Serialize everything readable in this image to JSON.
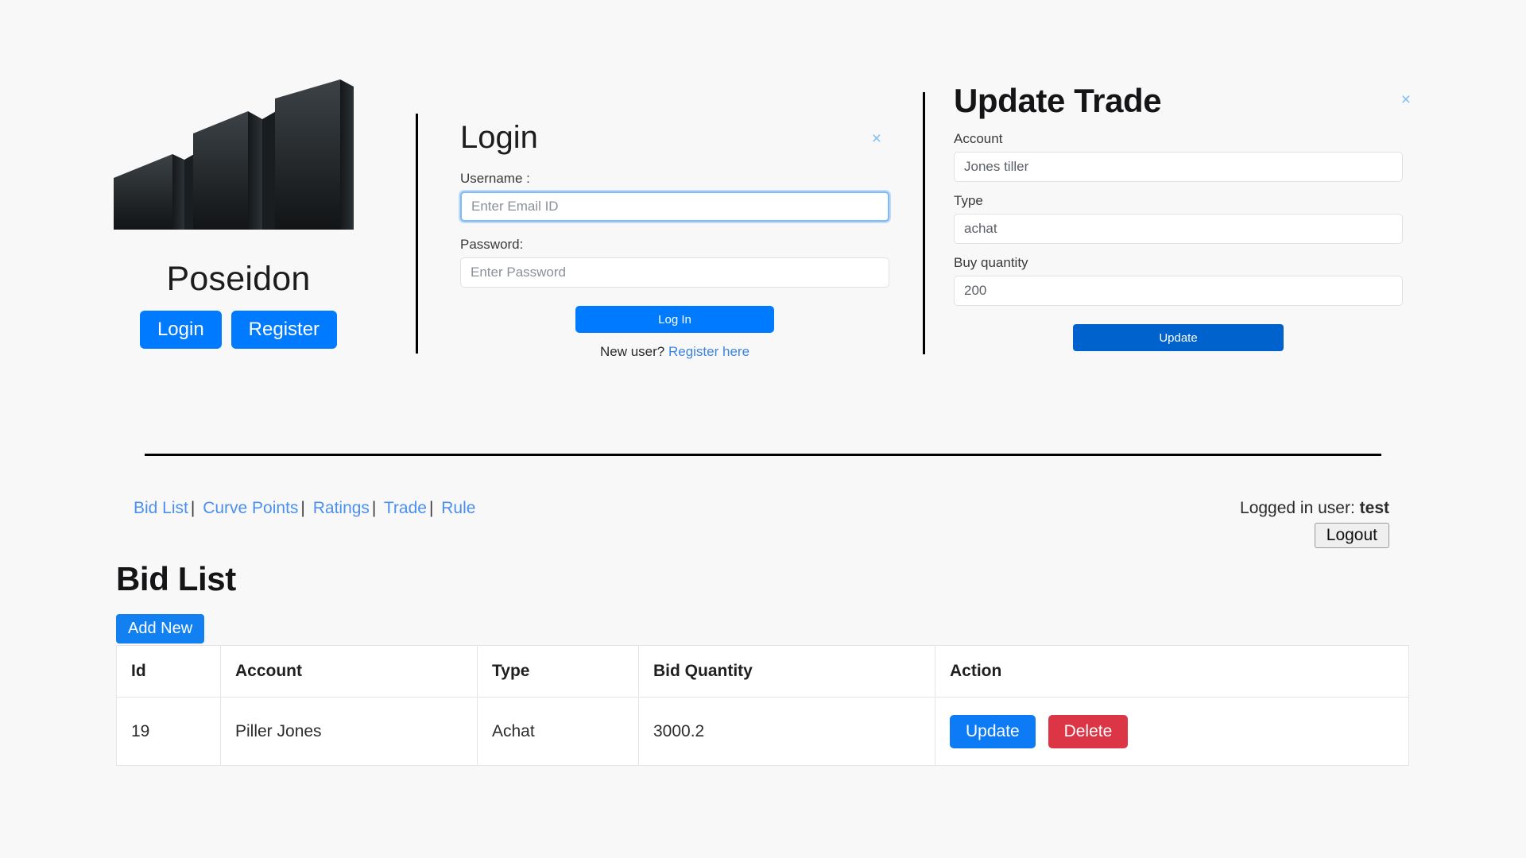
{
  "brand": {
    "name": "Poseidon",
    "logo_icon": "poseidon-bars-logo",
    "login_button": "Login",
    "register_button": "Register"
  },
  "login_panel": {
    "title": "Login",
    "close_icon": "×",
    "username_label": "Username :",
    "username_placeholder": "Enter Email ID",
    "username_value": "",
    "password_label": "Password:",
    "password_placeholder": "Enter Password",
    "password_value": "",
    "submit_label": "Log In",
    "footer_text": "New user?",
    "register_link": "Register here"
  },
  "trade_panel": {
    "title": "Update Trade",
    "close_icon": "×",
    "account_label": "Account",
    "account_value": "Jones tiller",
    "type_label": "Type",
    "type_value": "achat",
    "quantity_label": "Buy quantity",
    "quantity_value": "200",
    "submit_label": "Update"
  },
  "nav": {
    "items": [
      {
        "label": "Bid List"
      },
      {
        "label": "Curve Points"
      },
      {
        "label": "Ratings"
      },
      {
        "label": "Trade"
      },
      {
        "label": "Rule"
      }
    ],
    "separator": "|"
  },
  "session": {
    "logged_in_prefix": "Logged in user:",
    "username": "test",
    "logout_label": "Logout"
  },
  "bid_list": {
    "title": "Bid List",
    "add_new_label": "Add New",
    "columns": [
      "Id",
      "Account",
      "Type",
      "Bid Quantity",
      "Action"
    ],
    "rows": [
      {
        "id": "19",
        "account": "Piller Jones",
        "type": "Achat",
        "quantity": "3000.2",
        "update_label": "Update",
        "delete_label": "Delete"
      }
    ]
  },
  "colors": {
    "page_background": "#f8f8f8",
    "primary_blue": "#007bff",
    "link_blue": "#4b90ef",
    "update_blue": "#0062cc",
    "danger_red": "#dc3545",
    "close_icon_blue": "#82bdf7",
    "divider_black": "#000000"
  }
}
